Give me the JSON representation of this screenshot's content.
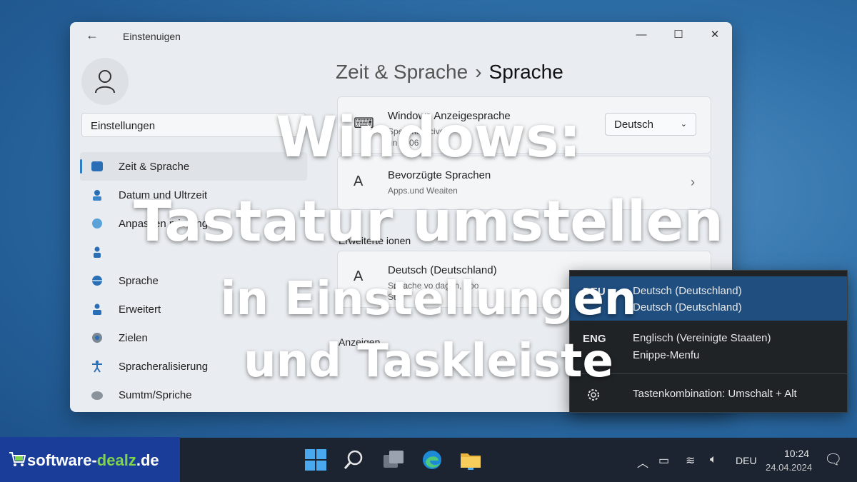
{
  "window": {
    "title": "Einstenuigen",
    "back_icon": "arrow-left-icon",
    "controls": [
      "minimize-icon",
      "maximize-icon",
      "close-icon"
    ]
  },
  "sidebar": {
    "search_value": "Einstellungen",
    "items": [
      {
        "label": "Zeit & Sprache",
        "icon": "time-language-icon",
        "active": true
      },
      {
        "label": "Datum und Ultrzeit",
        "icon": "clock-icon"
      },
      {
        "label": "Anpassen mierung",
        "icon": "region-icon"
      },
      {
        "label": "",
        "icon": "person-icon"
      },
      {
        "label": "Sprache",
        "icon": "language-icon"
      },
      {
        "label": "Erweitert",
        "icon": "advanced-icon"
      },
      {
        "label": "Zielen",
        "icon": "target-icon"
      },
      {
        "label": "Spracheralisierung",
        "icon": "accessibility-icon"
      },
      {
        "label": "Sumtm/Spriche",
        "icon": "speech-icon"
      }
    ]
  },
  "breadcrumb": {
    "parent": "Zeit & Sprache",
    "separator": "›",
    "current": "Sprache"
  },
  "cards": {
    "display_language": {
      "title": "Windows Anzeigesprache",
      "sub1": "Speic   ntsvicive",
      "sub2": "un   4306",
      "dropdown_value": "Deutsch"
    },
    "preferred_languages": {
      "title": "Bevorzügte Sprachen",
      "sub": "Apps.und Weaiten"
    },
    "section_advanced": "Erweiterte      ionen",
    "german": {
      "title": "Deutsch (Deutschland)",
      "sub1": "Speache vo   dagen, Aoo",
      "sub2": "Suc"
    },
    "section_display": "Anzeigen"
  },
  "flyout": {
    "items": [
      {
        "code": "DEU",
        "line1": "Deutsch (Deutschland)",
        "line2": "Deutsch (Deutschland)",
        "selected": true
      },
      {
        "code": "ENG",
        "line1": "Englisch (Vereinigte Staaten)",
        "line2": "Enippe-Menfu",
        "selected": false
      }
    ],
    "shortcut": "Tastenkombination: Umschalt + Alt",
    "gear_icon": "gear-icon"
  },
  "headline": {
    "line1": "Windows:",
    "line2": "Tastatur umstellen",
    "line3": "in Einstellungen",
    "line4": "und Taskleiste"
  },
  "taskbar": {
    "apps": [
      "windows-start-icon",
      "search-icon",
      "task-view-icon",
      "edge-browser-icon",
      "file-explorer-icon"
    ],
    "tray": {
      "language": "DEU",
      "time": "10:24",
      "date": "24.04.2024"
    }
  },
  "brand": {
    "prefix": "software-",
    "highlight": "dealz",
    "suffix": ".de"
  }
}
